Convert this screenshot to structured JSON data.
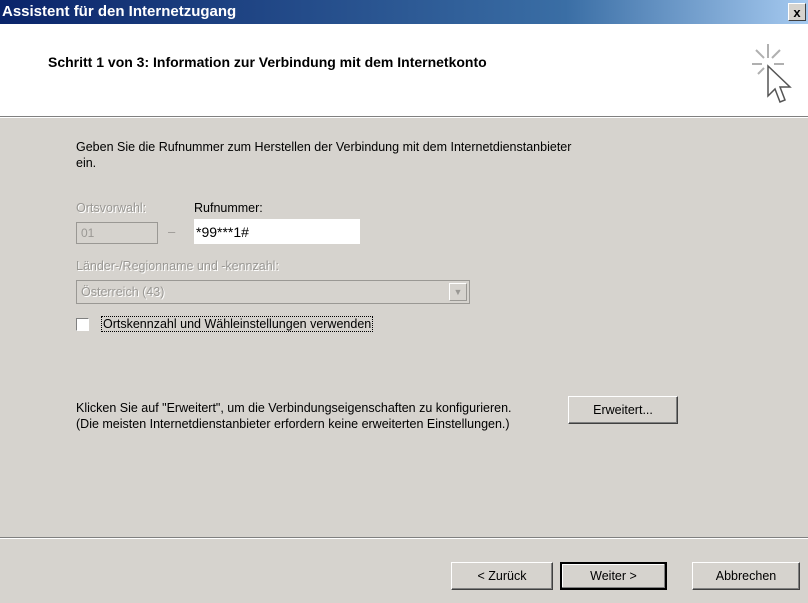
{
  "window": {
    "title": "Assistent für den Internetzugang",
    "close_label": "x"
  },
  "header": {
    "step_title": "Schritt 1 von 3: Information zur Verbindung mit dem Internetkonto"
  },
  "form": {
    "intro": "Geben Sie die Rufnummer zum Herstellen der Verbindung mit dem Internetdienstanbieter ein.",
    "area_code_label": "Ortsvorwahl:",
    "area_code_value": "01",
    "dash": "–",
    "phone_label": "Rufnummer:",
    "phone_value": "*99***1#",
    "country_label": "Länder-/Regionname und -kennzahl:",
    "country_value": "Österreich (43)",
    "use_area_code_label": "Ortskennzahl und Wähleinstellungen verwenden",
    "use_area_code_checked": false
  },
  "advanced": {
    "text": "Klicken Sie auf \"Erweitert\", um die Verbindungseigenschaften zu konfigurieren.\n(Die meisten Internetdienstanbieter erfordern keine erweiterten Einstellungen.)",
    "button_label": "Erweitert..."
  },
  "footer": {
    "back_label": "< Zurück",
    "next_label": "Weiter >",
    "cancel_label": "Abbrechen"
  }
}
